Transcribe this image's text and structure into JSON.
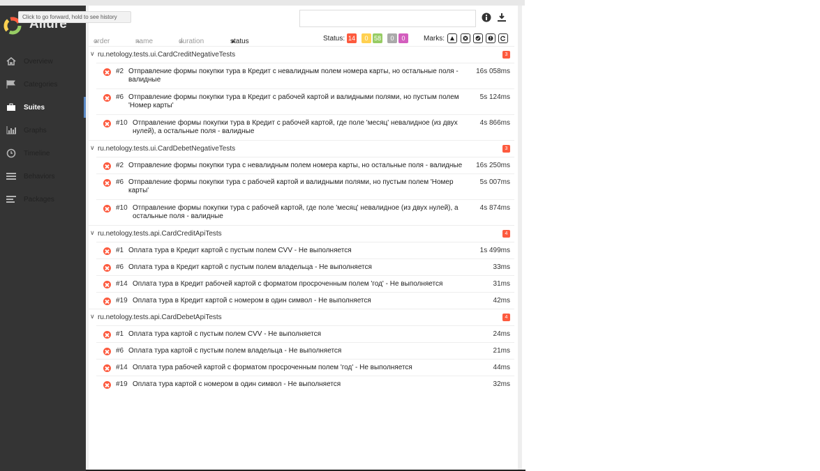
{
  "app": {
    "brand": "Allure",
    "tooltip": "Click to go forward, hold to see history"
  },
  "sidebar": {
    "items": [
      {
        "label": "Overview",
        "icon": "home-icon"
      },
      {
        "label": "Categories",
        "icon": "flag-icon"
      },
      {
        "label": "Suites",
        "icon": "briefcase-icon",
        "active": true
      },
      {
        "label": "Graphs",
        "icon": "bar-chart-icon"
      },
      {
        "label": "Timeline",
        "icon": "clock-icon"
      },
      {
        "label": "Behaviors",
        "icon": "list-icon"
      },
      {
        "label": "Packages",
        "icon": "align-left-icon"
      }
    ]
  },
  "toolbar": {
    "search_placeholder": ""
  },
  "sort": {
    "order": "order",
    "name": "name",
    "duration": "duration",
    "status": "status"
  },
  "status_filter": {
    "label": "Status:",
    "counts": [
      {
        "value": "14",
        "color": "#fd5a3e"
      },
      {
        "value": "0",
        "color": "#ffd050"
      },
      {
        "value": "58",
        "color": "#97cc64"
      },
      {
        "value": "0",
        "color": "#aaaaaa"
      },
      {
        "value": "0",
        "color": "#d35ebe"
      }
    ]
  },
  "marks": {
    "label": "Marks:"
  },
  "suites": [
    {
      "name": "ru.netology.tests.ui.CardCreditNegativeTests",
      "count": "3",
      "tests": [
        {
          "num": "#2",
          "title": "Отправление формы покупки тура в Кредит с невалидным полем номера карты, но остальные поля - валидные",
          "duration": "16s 058ms"
        },
        {
          "num": "#6",
          "title": "Отправление формы покупки тура в Кредит с рабочей картой и валидными полями, но пустым полем 'Номер карты'",
          "duration": "5s 124ms"
        },
        {
          "num": "#10",
          "title": "Отправление формы покупки тура в Кредит с рабочей картой, где поле 'месяц' невалидное (из двух нулей), а остальные поля - валидные",
          "duration": "4s 866ms"
        }
      ]
    },
    {
      "name": "ru.netology.tests.ui.CardDebetNegativeTests",
      "count": "3",
      "tests": [
        {
          "num": "#2",
          "title": "Отправление формы покупки тура с невалидным полем номера карты, но остальные поля - валидные",
          "duration": "16s 250ms"
        },
        {
          "num": "#6",
          "title": "Отправление формы покупки тура с рабочей картой и валидными полями, но пустым полем 'Номер карты'",
          "duration": "5s 007ms"
        },
        {
          "num": "#10",
          "title": "Отправление формы покупки тура с рабочей картой, где поле 'месяц' невалидное (из двух нулей), а остальные поля - валидные",
          "duration": "4s 874ms"
        }
      ]
    },
    {
      "name": "ru.netology.tests.api.CardCreditApiTests",
      "count": "4",
      "tests": [
        {
          "num": "#1",
          "title": "Оплата тура в Кредит картой с пустым полем CVV - Не выполняется",
          "duration": "1s 499ms"
        },
        {
          "num": "#6",
          "title": "Оплата тура в Кредит картой с пустым полем владельца - Не выполняется",
          "duration": "33ms"
        },
        {
          "num": "#14",
          "title": "Оплата тура в Кредит рабочей картой с форматом просроченным полем 'год' - Не выполняется",
          "duration": "31ms"
        },
        {
          "num": "#19",
          "title": "Оплата тура в Кредит картой с номером в один символ - Не выполняется",
          "duration": "42ms"
        }
      ]
    },
    {
      "name": "ru.netology.tests.api.CardDebetApiTests",
      "count": "4",
      "tests": [
        {
          "num": "#1",
          "title": "Оплата тура картой с пустым полем CVV - Не выполняется",
          "duration": "24ms"
        },
        {
          "num": "#6",
          "title": "Оплата тура картой с пустым полем владельца - Не выполняется",
          "duration": "21ms"
        },
        {
          "num": "#14",
          "title": "Оплата тура рабочей картой с форматом просроченным полем 'год' - Не выполняется",
          "duration": "44ms"
        },
        {
          "num": "#19",
          "title": "Оплата тура картой с номером в один символ - Не выполняется",
          "duration": "32ms"
        }
      ]
    }
  ]
}
